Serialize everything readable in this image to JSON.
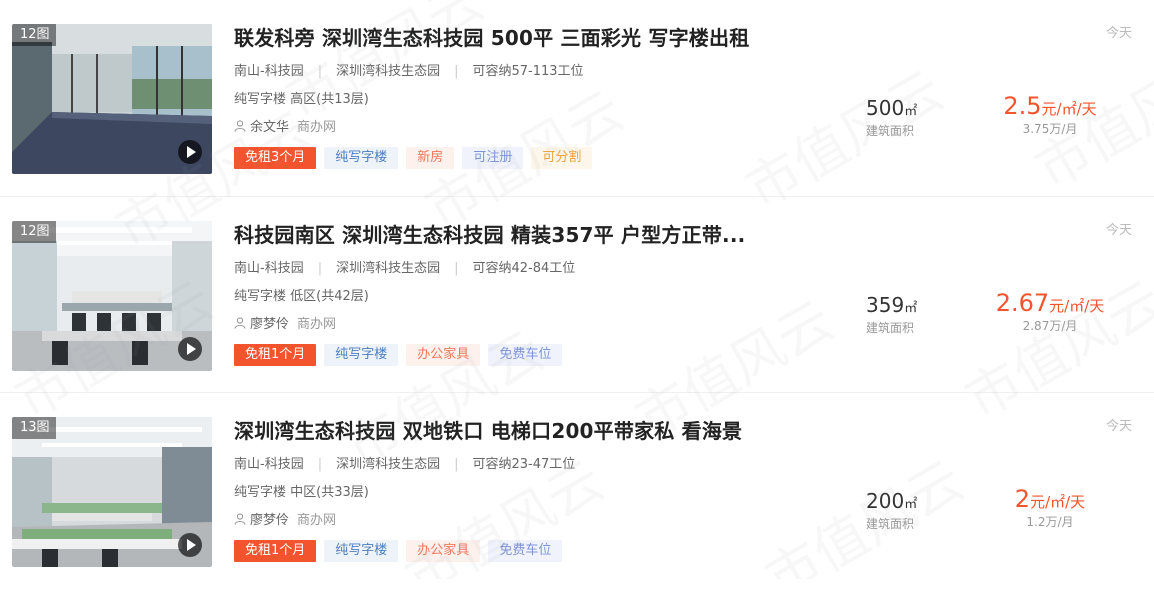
{
  "listings": [
    {
      "image_count": "12图",
      "title": "联发科旁 深圳湾生态科技园 500平 三面彩光 写字楼出租",
      "district": "南山-科技园",
      "park": "深圳湾科技生态园",
      "capacity": "可容纳57-113工位",
      "building_type": "纯写字楼 高区(共13层)",
      "agent": "余文华",
      "source": "商办网",
      "tags": [
        "免租3个月",
        "纯写字楼",
        "新房",
        "可注册",
        "可分割"
      ],
      "area_value": "500",
      "area_unit": "㎡",
      "area_label": "建筑面积",
      "price_value": "2.5",
      "price_unit": "元/㎡/天",
      "monthly": "3.75万/月",
      "date": "今天"
    },
    {
      "image_count": "12图",
      "title": "科技园南区 深圳湾生态科技园 精装357平 户型方正带...",
      "district": "南山-科技园",
      "park": "深圳湾科技生态园",
      "capacity": "可容纳42-84工位",
      "building_type": "纯写字楼 低区(共42层)",
      "agent": "廖梦伶",
      "source": "商办网",
      "tags": [
        "免租1个月",
        "纯写字楼",
        "办公家具",
        "免费车位"
      ],
      "area_value": "359",
      "area_unit": "㎡",
      "area_label": "建筑面积",
      "price_value": "2.67",
      "price_unit": "元/㎡/天",
      "monthly": "2.87万/月",
      "date": "今天"
    },
    {
      "image_count": "13图",
      "title": "深圳湾生态科技园 双地铁口 电梯口200平带家私 看海景",
      "district": "南山-科技园",
      "park": "深圳湾科技生态园",
      "capacity": "可容纳23-47工位",
      "building_type": "纯写字楼 中区(共33层)",
      "agent": "廖梦伶",
      "source": "商办网",
      "tags": [
        "免租1个月",
        "纯写字楼",
        "办公家具",
        "免费车位"
      ],
      "area_value": "200",
      "area_unit": "㎡",
      "area_label": "建筑面积",
      "price_value": "2",
      "price_unit": "元/㎡/天",
      "monthly": "1.2万/月",
      "date": "今天"
    }
  ],
  "watermark": "市值风云",
  "colors": {
    "accent": "#f4542d",
    "tag_blue": "#4b7fc2",
    "tag_pink": "#f2775a",
    "tag_lavender": "#7d93d8",
    "tag_orange": "#f2a33c"
  }
}
